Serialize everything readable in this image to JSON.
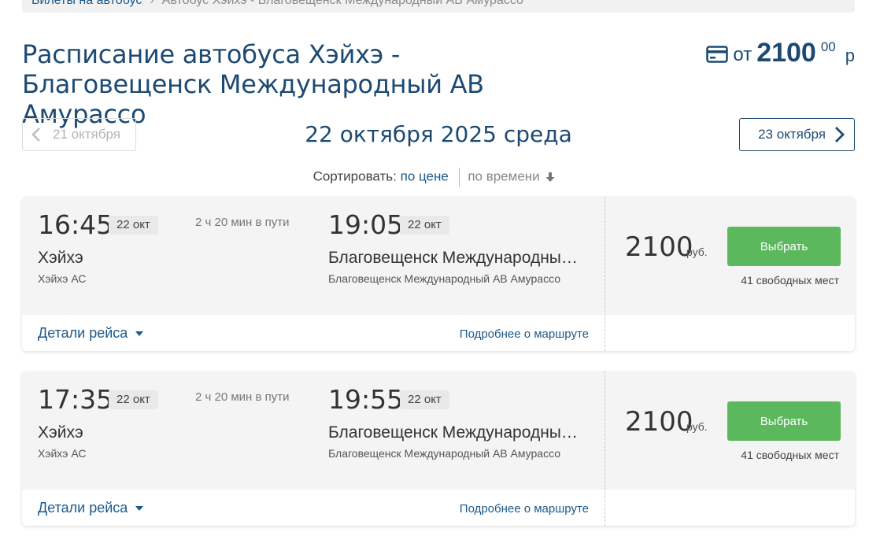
{
  "breadcrumb": {
    "link": "Билеты на автобус",
    "current": "Автобус Хэйхэ - Благовещенск Международный АВ Амурассо"
  },
  "header": {
    "title": "Расписание автобуса Хэйхэ - Благовещенск Международный АВ Амурассо",
    "price_from_label": "от",
    "price_from_amount": "2100",
    "price_from_cents": "00",
    "price_from_currency": "р",
    "price_icon": "credit-card-icon"
  },
  "date_nav": {
    "prev_label": "21 октября",
    "current_label": "22 октября 2025 среда",
    "next_label": "23 октября"
  },
  "sort": {
    "label": "Сортировать:",
    "by_price": "по цене",
    "by_time": "по времени"
  },
  "colors": {
    "title_blue": "#1d4a72",
    "link_blue": "#1b5a8c",
    "select_green": "#5cb85c"
  },
  "trips": [
    {
      "departure_time": "16:45",
      "departure_date": "22 окт",
      "duration": "2 ч 20 мин в пути",
      "arrival_time": "19:05",
      "arrival_date": "22 окт",
      "from_city": "Хэйхэ",
      "from_station": "Хэйхэ АС",
      "to_city": "Благовещенск Международный АВ Амурассо",
      "to_station": "Благовещенск Международный АВ Амурассо",
      "details_label": "Детали рейса",
      "route_label": "Подробнее о маршруте",
      "price": "2100",
      "price_unit": "руб.",
      "select_label": "Выбрать",
      "seats": "41 свободных мест"
    },
    {
      "departure_time": "17:35",
      "departure_date": "22 окт",
      "duration": "2 ч 20 мин в пути",
      "arrival_time": "19:55",
      "arrival_date": "22 окт",
      "from_city": "Хэйхэ",
      "from_station": "Хэйхэ АС",
      "to_city": "Благовещенск Международный АВ Амурассо",
      "to_station": "Благовещенск Международный АВ Амурассо",
      "details_label": "Детали рейса",
      "route_label": "Подробнее о маршруте",
      "price": "2100",
      "price_unit": "руб.",
      "select_label": "Выбрать",
      "seats": "41 свободных мест"
    }
  ]
}
